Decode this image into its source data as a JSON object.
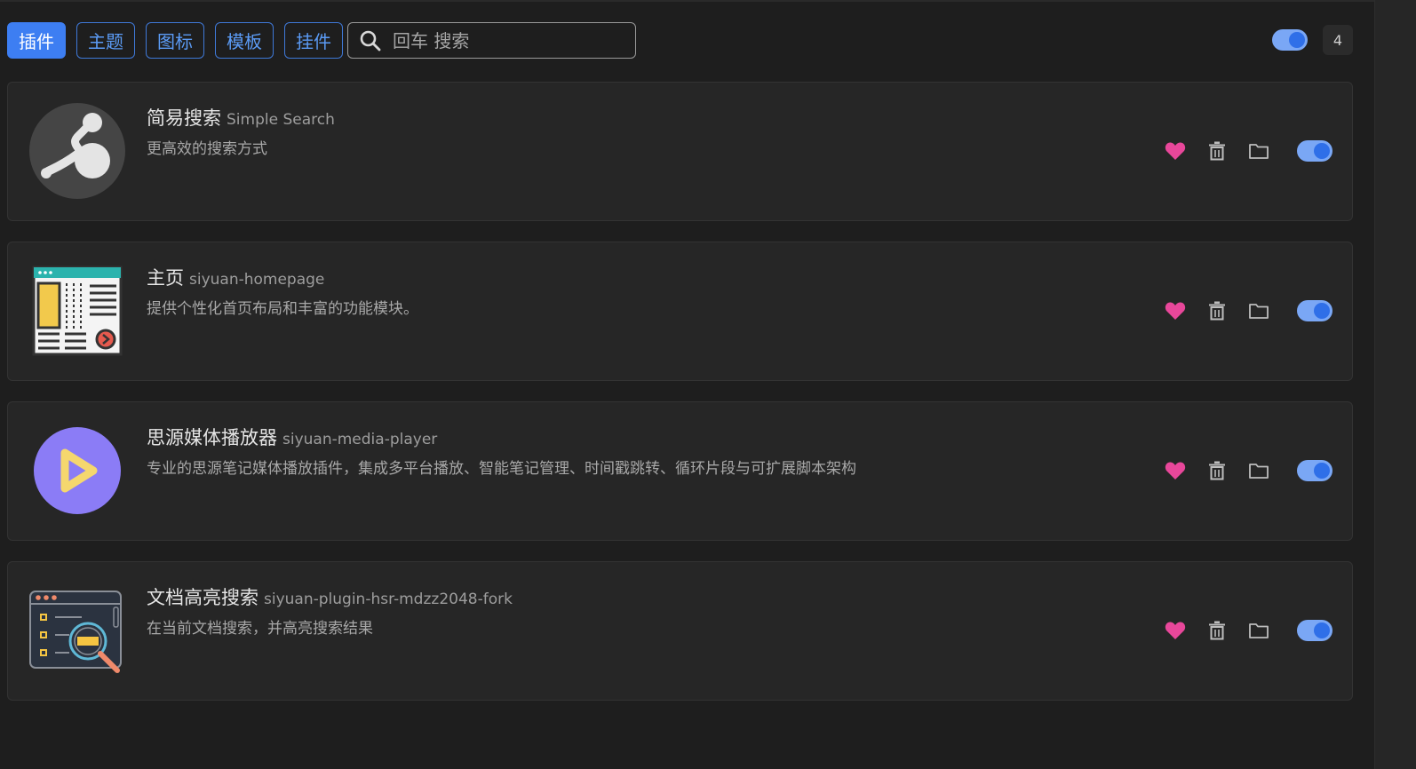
{
  "tabs": [
    {
      "label": "插件",
      "active": true
    },
    {
      "label": "主题",
      "active": false
    },
    {
      "label": "图标",
      "active": false
    },
    {
      "label": "模板",
      "active": false
    },
    {
      "label": "挂件",
      "active": false
    }
  ],
  "search": {
    "placeholder": "回车 搜索",
    "value": ""
  },
  "global_enabled": true,
  "count": "4",
  "colors": {
    "accent": "#3d7ef2",
    "heart": "#e8479a",
    "toggle_track": "#7aa7f5",
    "toggle_knob": "#2f6fe8"
  },
  "plugins": [
    {
      "name": "简易搜索",
      "package": "Simple Search",
      "description": "更高效的搜索方式",
      "icon": "simple-search-logo",
      "enabled": true
    },
    {
      "name": "主页",
      "package": "siyuan-homepage",
      "description": "提供个性化首页布局和丰富的功能模块。",
      "icon": "homepage-layout-logo",
      "enabled": true
    },
    {
      "name": "思源媒体播放器",
      "package": "siyuan-media-player",
      "description": "专业的思源笔记媒体播放插件，集成多平台播放、智能笔记管理、时间戳跳转、循环片段与可扩展脚本架构",
      "icon": "media-player-logo",
      "enabled": true
    },
    {
      "name": "文档高亮搜索",
      "package": "siyuan-plugin-hsr-mdzz2048-fork",
      "description": "在当前文档搜索，并高亮搜索结果",
      "icon": "document-search-logo",
      "enabled": true
    }
  ]
}
